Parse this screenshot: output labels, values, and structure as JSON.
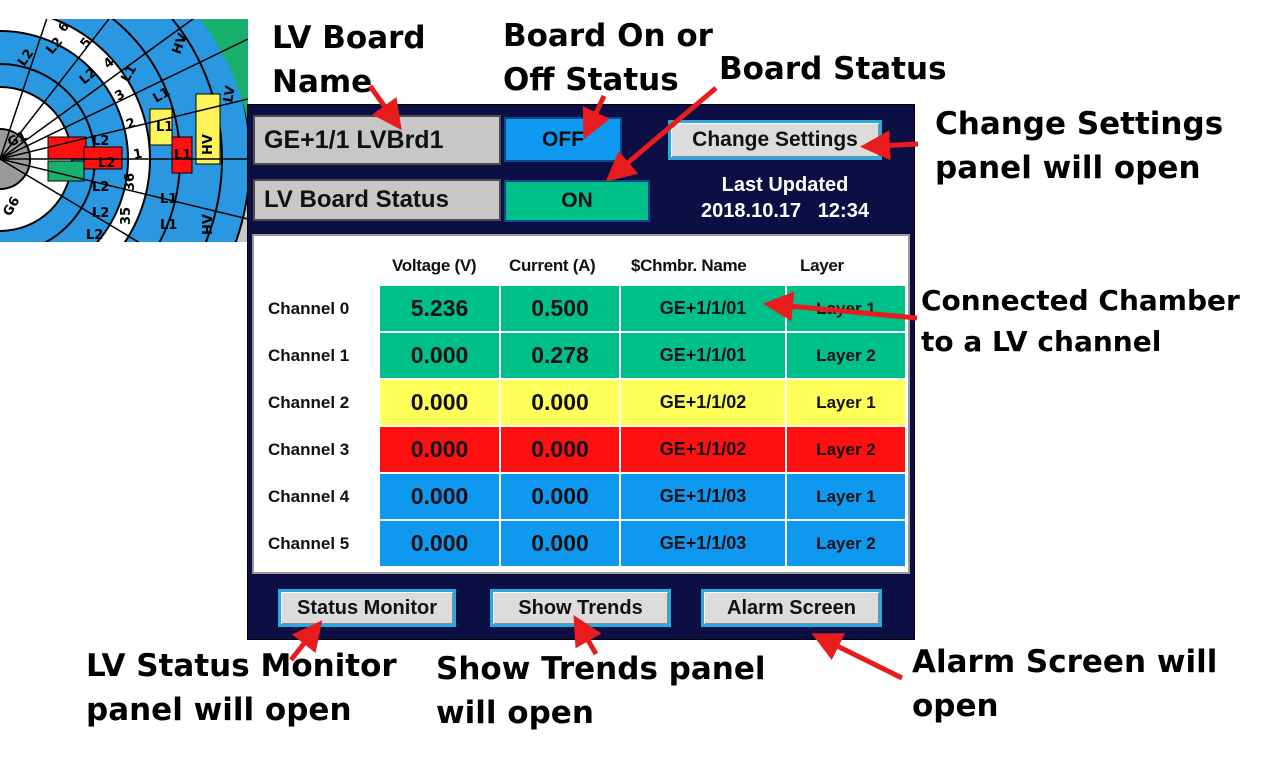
{
  "wheel": {
    "labels": [
      "G1",
      "G6",
      "L2",
      "L1",
      "HV",
      "1",
      "2",
      "3",
      "4",
      "5",
      "6",
      "36",
      "35"
    ]
  },
  "panel": {
    "board_name": "GE+1/1 LVBrd1",
    "on_off_status": "OFF",
    "change_settings_label": "Change Settings",
    "board_status_label": "LV Board Status",
    "board_status_value": "ON",
    "last_updated_label": "Last Updated",
    "last_updated_value": "2018.10.17   12:34",
    "headers": {
      "voltage": "Voltage (V)",
      "current": "Current (A)",
      "chamber": "$Chmbr. Name",
      "layer": "Layer"
    },
    "channels": [
      {
        "label": "Channel 0",
        "voltage": "5.236",
        "current": "0.500",
        "chamber": "GE+1/1/01",
        "layer": "Layer 1",
        "color": "#00c08a"
      },
      {
        "label": "Channel 1",
        "voltage": "0.000",
        "current": "0.278",
        "chamber": "GE+1/1/01",
        "layer": "Layer 2",
        "color": "#00c08a"
      },
      {
        "label": "Channel 2",
        "voltage": "0.000",
        "current": "0.000",
        "chamber": "GE+1/1/02",
        "layer": "Layer 1",
        "color": "#ffff5a"
      },
      {
        "label": "Channel 3",
        "voltage": "0.000",
        "current": "0.000",
        "chamber": "GE+1/1/02",
        "layer": "Layer 2",
        "color": "#ff1010"
      },
      {
        "label": "Channel 4",
        "voltage": "0.000",
        "current": "0.000",
        "chamber": "GE+1/1/03",
        "layer": "Layer 1",
        "color": "#0f98f0"
      },
      {
        "label": "Channel 5",
        "voltage": "0.000",
        "current": "0.000",
        "chamber": "GE+1/1/03",
        "layer": "Layer 2",
        "color": "#0f98f0"
      }
    ],
    "buttons": {
      "status_monitor": "Status Monitor",
      "show_trends": "Show Trends",
      "alarm_screen": "Alarm Screen"
    },
    "colors": {
      "panel_bg": "#0c0f44",
      "off_box": "#0f98f0",
      "on_box": "#00c08a"
    }
  },
  "annotations": {
    "lv_board_name_1": "LV Board",
    "lv_board_name_2": "Name",
    "on_off_1": "Board On or",
    "on_off_2": "Off Status",
    "board_status": "Board Status",
    "change_settings_1": "Change Settings",
    "change_settings_2": "panel will open",
    "connected_1": "Connected Chamber",
    "connected_2": "to a LV channel",
    "status_monitor_1": "LV Status Monitor",
    "status_monitor_2": "panel will open",
    "show_trends_1": "Show Trends panel",
    "show_trends_2": "will open",
    "alarm_1": "Alarm Screen will",
    "alarm_2": "open"
  }
}
